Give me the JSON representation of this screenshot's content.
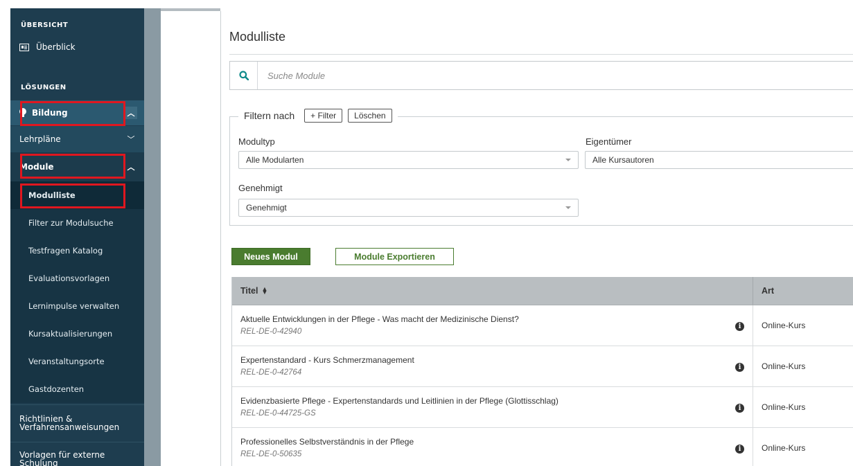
{
  "sidebar": {
    "section_overview": "ÜBERSICHT",
    "overview_item": "Überblick",
    "section_solutions": "LÖSUNGEN",
    "bildung": "Bildung",
    "lehrplaene": "Lehrpläne",
    "module": "Module",
    "sub_items": [
      "Modulliste",
      "Filter zur Modulsuche",
      "Testfragen Katalog",
      "Evaluationsvorlagen",
      "Lernimpulse verwalten",
      "Kursaktualisierungen",
      "Veranstaltungsorte",
      "Gastdozenten"
    ],
    "richtlinien": "Richtlinien & Verfahrensanweisungen",
    "vorlagen": "Vorlagen für externe Schulung"
  },
  "page": {
    "title": "Modulliste",
    "search_placeholder": "Suche Module"
  },
  "filters": {
    "legend": "Filtern nach",
    "add_filter": "+ Filter",
    "clear": "Löschen",
    "modultyp_label": "Modultyp",
    "modultyp_value": "Alle Modularten",
    "eigentuemer_label": "Eigentümer",
    "eigentuemer_value": "Alle Kursautoren",
    "genehmigt_label": "Genehmigt",
    "genehmigt_value": "Genehmigt"
  },
  "actions": {
    "new_module": "Neues Modul",
    "export_modules": "Module Exportieren"
  },
  "table": {
    "col_title": "Titel",
    "col_art": "Art",
    "rows": [
      {
        "title": "Aktuelle Entwicklungen in der Pflege - Was macht der Medizinische Dienst?",
        "id": "REL-DE-0-42940",
        "art": "Online-Kurs"
      },
      {
        "title": "Expertenstandard - Kurs Schmerzmanagement",
        "id": "REL-DE-0-42764",
        "art": "Online-Kurs"
      },
      {
        "title": "Evidenzbasierte Pflege - Expertenstandards und Leitlinien in der Pflege (Glottisschlag)",
        "id": "REL-DE-0-44725-GS",
        "art": "Online-Kurs"
      },
      {
        "title": "Professionelles Selbstverständnis in der Pflege",
        "id": "REL-DE-0-50635",
        "art": "Online-Kurs"
      }
    ]
  },
  "colors": {
    "sidebar_bg": "#1e3d4f",
    "primary_green": "#4a7c2f",
    "highlight_red": "#e0171f",
    "search_icon": "#0e8a8a"
  }
}
